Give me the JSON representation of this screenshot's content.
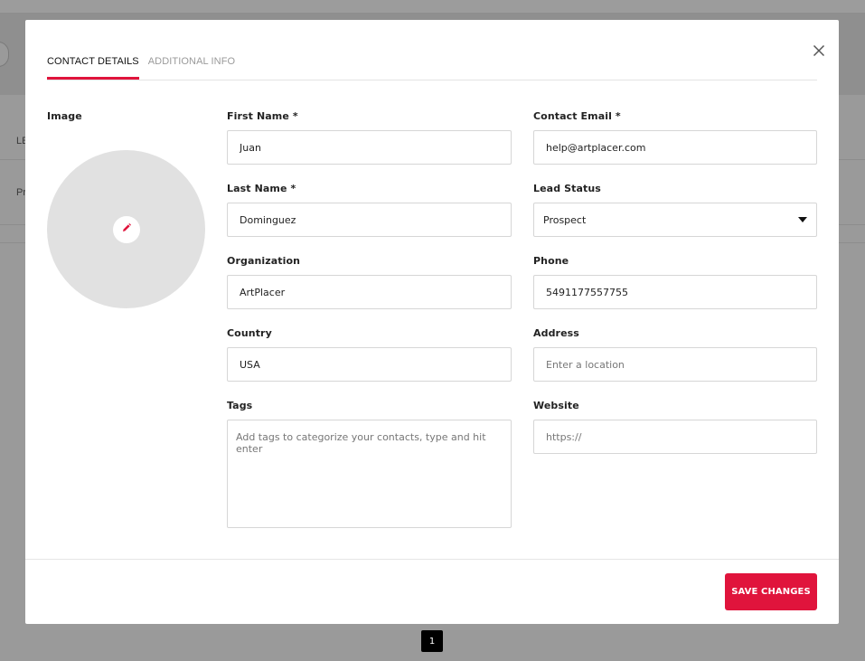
{
  "background": {
    "column_header_partial": "LE",
    "row_text_partial": "Pr",
    "pagination_current": "1"
  },
  "modal": {
    "tabs": [
      {
        "label": "CONTACT DETAILS",
        "active": true
      },
      {
        "label": "ADDITIONAL INFO",
        "active": false
      }
    ],
    "image_label": "Image",
    "fields": {
      "first_name": {
        "label": "First Name *",
        "value": "Juan"
      },
      "last_name": {
        "label": "Last Name *",
        "value": "Dominguez"
      },
      "organization": {
        "label": "Organization",
        "value": "ArtPlacer"
      },
      "country": {
        "label": "Country",
        "value": "USA"
      },
      "tags": {
        "label": "Tags",
        "placeholder": "Add tags to categorize your contacts, type and hit enter"
      },
      "contact_email": {
        "label": "Contact Email *",
        "value": "help@artplacer.com"
      },
      "lead_status": {
        "label": "Lead Status",
        "value": "Prospect"
      },
      "phone": {
        "label": "Phone",
        "value": "5491177557755"
      },
      "address": {
        "label": "Address",
        "placeholder": "Enter a location"
      },
      "website": {
        "label": "Website",
        "placeholder": "https://"
      }
    },
    "save_label": "SAVE CHANGES"
  },
  "colors": {
    "accent": "#e0143c",
    "overlay": "#9a9a9a",
    "avatar_bg": "#e1e1e1"
  },
  "icons": [
    "close-icon",
    "pencil-icon",
    "chevron-down-icon"
  ]
}
